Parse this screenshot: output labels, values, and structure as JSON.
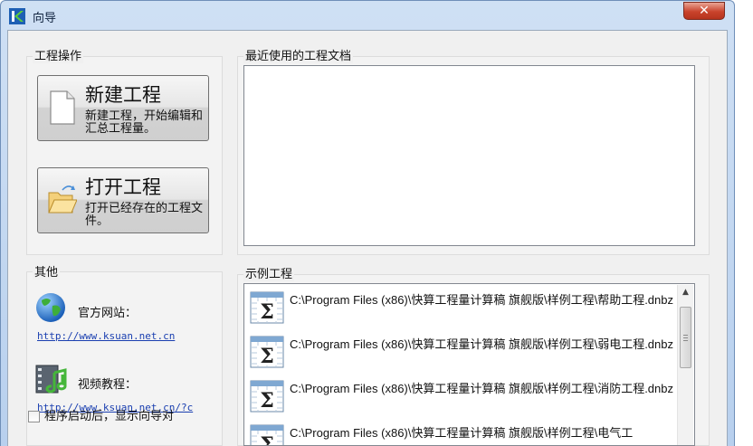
{
  "window": {
    "title": "向导",
    "close_glyph": "✕"
  },
  "project_ops": {
    "label": "工程操作",
    "new_project": {
      "title": "新建工程",
      "desc": "新建工程，开始编辑和汇总工程量。",
      "icon": "document-icon"
    },
    "open_project": {
      "title": "打开工程",
      "desc": "打开已经存在的工程文件。",
      "icon": "folder-open-icon"
    }
  },
  "recent": {
    "label": "最近使用的工程文档",
    "items": []
  },
  "other": {
    "label": "其他",
    "website_label": "官方网站：",
    "website_url": "http://www.ksuan.net.cn",
    "video_label": "视频教程：",
    "video_url": "http://www.ksuan.net.cn/?c",
    "startup_checkbox_label": "程序启动后，显示向导对"
  },
  "examples": {
    "label": "示例工程",
    "items": [
      "C:\\Program Files (x86)\\快算工程量计算稿 旗舰版\\样例工程\\帮助工程.dnbz",
      "C:\\Program Files (x86)\\快算工程量计算稿 旗舰版\\样例工程\\弱电工程.dnbz",
      "C:\\Program Files (x86)\\快算工程量计算稿 旗舰版\\样例工程\\消防工程.dnbz",
      "C:\\Program Files (x86)\\快算工程量计算稿 旗舰版\\样例工程\\电气工"
    ]
  },
  "colors": {
    "title_bar": "#cfe0f4",
    "close_button": "#c9432c",
    "link": "#1a3fb0"
  }
}
